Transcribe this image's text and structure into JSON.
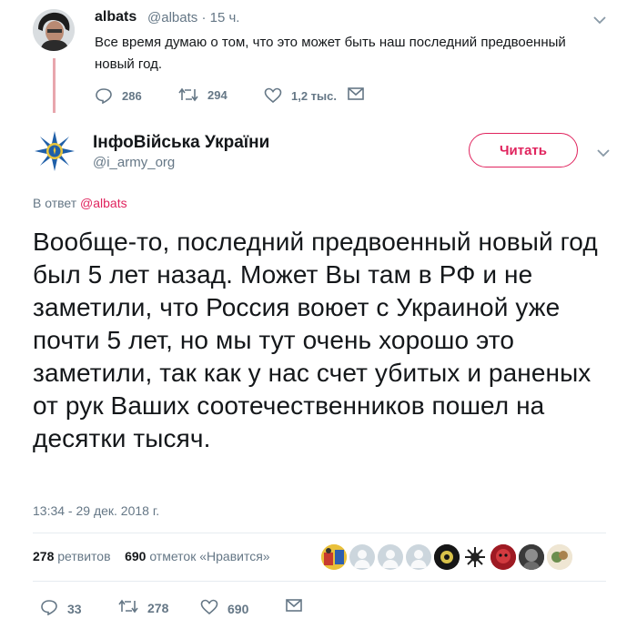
{
  "parent_tweet": {
    "name": "albats",
    "handle": "@albats",
    "separator": "·",
    "time": "15 ч.",
    "caret": "⌄",
    "text": "Все время думаю о том, что это может быть наш последний предвоенный новый год.",
    "replies": "286",
    "retweets": "294",
    "likes": "1,2 тыс."
  },
  "main_tweet": {
    "name": "ІнфоВійська України",
    "handle": "@i_army_org",
    "follow_label": "Читать",
    "caret": "⌄",
    "reply_prefix": "В ответ",
    "reply_handle": "@albats",
    "text": "Вообще-то, последний предвоенный новый год был 5 лет назад. Может Вы там в РФ и не заметили, что Россия воюет с Украиной уже почти 5 лет, но мы тут очень хорошо это заметили, так как у нас счет убитых и раненых от рук Ваших соотечественников пошел на десятки тысяч.",
    "timestamp": "13:34 - 29 дек. 2018 г.",
    "stats": {
      "retweets_count": "278",
      "retweets_label": "ретвитов",
      "likes_count": "690",
      "likes_label": "отметок «Нравится»"
    },
    "actions": {
      "replies": "33",
      "retweets": "278",
      "likes": "690"
    }
  },
  "colors": {
    "accent": "#e0245e",
    "muted": "#657786",
    "thread_line": "#e8a6ad"
  }
}
